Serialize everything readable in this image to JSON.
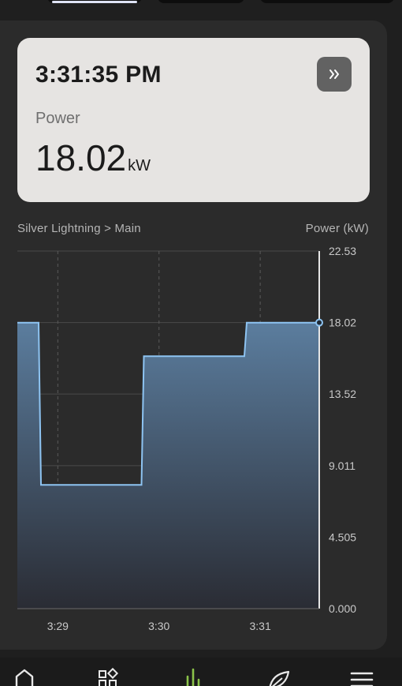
{
  "header": {
    "time": "3:31:35 PM",
    "expand_icon": "chevron-double-right-icon"
  },
  "metric": {
    "label": "Power",
    "value": "18.02",
    "unit": "kW"
  },
  "chart_header": {
    "breadcrumb": "Silver Lightning > Main",
    "axis_title": "Power (kW)"
  },
  "chart_data": {
    "type": "area",
    "style": "step",
    "ylabel": "Power (kW)",
    "ylim": [
      0,
      22.53
    ],
    "y_ticks": [
      "22.53",
      "18.02",
      "13.52",
      "9.011",
      "4.505",
      "0.000"
    ],
    "y_tick_values": [
      22.53,
      18.02,
      13.52,
      9.011,
      4.505,
      0
    ],
    "x_ticks": [
      "3:29",
      "3:30",
      "3:31"
    ],
    "x_tick_values": [
      "15:29",
      "15:30",
      "15:31"
    ],
    "xlim": [
      "15:28:36",
      "15:31:35"
    ],
    "series": [
      {
        "x": [
          "15:28:36",
          "15:28:50",
          "15:29:51",
          "15:30:52",
          "15:31:35"
        ],
        "y": [
          18.02,
          7.8,
          15.9,
          18.02,
          18.02
        ]
      }
    ],
    "current_value": 18.02,
    "grid": true,
    "line_color": "#8ec4f2",
    "fill_color_top": "#5b7d9e",
    "fill_color_bottom": "#2a2c34"
  },
  "nav": {
    "items": [
      {
        "icon": "home-icon"
      },
      {
        "icon": "widgets-icon"
      },
      {
        "icon": "bar-chart-icon",
        "active": true
      },
      {
        "icon": "leaf-icon"
      },
      {
        "icon": "menu-icon"
      }
    ],
    "active_color": "#8bc34a"
  },
  "colors": {
    "card_bg": "#e6e4e2",
    "panel_bg": "#2b2b2b",
    "page_bg": "#1f1f1f"
  }
}
